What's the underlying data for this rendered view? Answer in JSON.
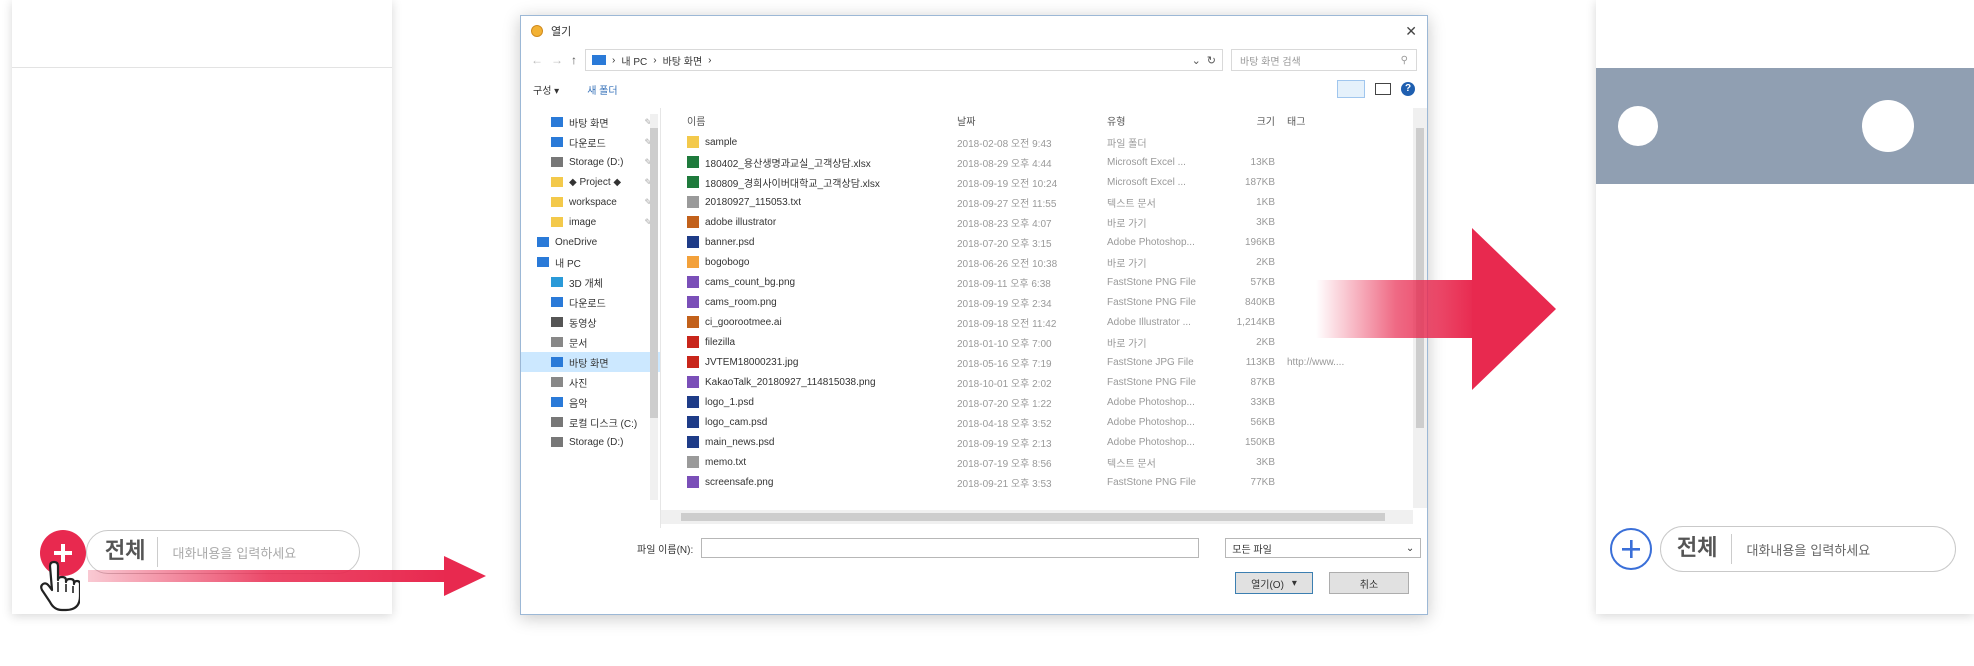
{
  "left_phone": {
    "all_label": "전체",
    "placeholder": "대화내용을 입력하세요"
  },
  "dialog": {
    "title": "열기",
    "address": {
      "pc": "내 PC",
      "folder": "바탕 화면"
    },
    "search_placeholder": "바탕 화면 검색",
    "toolbar": {
      "organize": "구성 ▾",
      "new_folder": "새 폴더"
    },
    "nav_items": [
      {
        "label": "바탕 화면",
        "icon": "desktop-icon",
        "color": "#2a7ad8",
        "pinned": true,
        "level": "sub"
      },
      {
        "label": "다운로드",
        "icon": "download-icon",
        "color": "#2a7ad8",
        "pinned": true,
        "level": "sub"
      },
      {
        "label": "Storage (D:)",
        "icon": "drive-icon",
        "color": "#777777",
        "pinned": true,
        "level": "sub"
      },
      {
        "label": "◆ Project ◆",
        "icon": "folder-icon",
        "color": "#f3c94b",
        "pinned": true,
        "level": "sub"
      },
      {
        "label": "workspace",
        "icon": "folder-icon",
        "color": "#f3c94b",
        "pinned": true,
        "level": "sub"
      },
      {
        "label": "image",
        "icon": "folder-icon",
        "color": "#f3c94b",
        "pinned": true,
        "level": "sub"
      },
      {
        "label": "OneDrive",
        "icon": "cloud-icon",
        "color": "#2a7ad8",
        "pinned": false,
        "level": "top"
      },
      {
        "label": "내 PC",
        "icon": "pc-icon",
        "color": "#2a7ad8",
        "pinned": false,
        "level": "top"
      },
      {
        "label": "3D 개체",
        "icon": "cube-icon",
        "color": "#2a9ad8",
        "pinned": false,
        "level": "sub"
      },
      {
        "label": "다운로드",
        "icon": "download-icon",
        "color": "#2a7ad8",
        "pinned": false,
        "level": "sub"
      },
      {
        "label": "동영상",
        "icon": "video-icon",
        "color": "#555555",
        "pinned": false,
        "level": "sub"
      },
      {
        "label": "문서",
        "icon": "document-icon",
        "color": "#888888",
        "pinned": false,
        "level": "sub"
      },
      {
        "label": "바탕 화면",
        "icon": "desktop-icon",
        "color": "#2a7ad8",
        "pinned": false,
        "level": "sub",
        "selected": true
      },
      {
        "label": "사진",
        "icon": "picture-icon",
        "color": "#888888",
        "pinned": false,
        "level": "sub"
      },
      {
        "label": "음악",
        "icon": "music-icon",
        "color": "#2a7ad8",
        "pinned": false,
        "level": "sub"
      },
      {
        "label": "로컬 디스크 (C:)",
        "icon": "drive-icon",
        "color": "#777777",
        "pinned": false,
        "level": "sub"
      },
      {
        "label": "Storage (D:)",
        "icon": "drive-icon",
        "color": "#777777",
        "pinned": false,
        "level": "sub"
      }
    ],
    "columns": {
      "name": "이름",
      "date": "날짜",
      "type": "유형",
      "size": "크기",
      "tag": "태그"
    },
    "files": [
      {
        "name": "sample",
        "date": "2018-02-08 오전 9:43",
        "type": "파일 폴더",
        "size": "",
        "tag": "",
        "color": "#f3c94b"
      },
      {
        "name": "180402_용산생명과교실_고객상담.xlsx",
        "date": "2018-08-29 오후 4:44",
        "type": "Microsoft Excel ...",
        "size": "13KB",
        "tag": "",
        "color": "#1f7a3c"
      },
      {
        "name": "180809_경희사이버대학교_고객상담.xlsx",
        "date": "2018-09-19 오전 10:24",
        "type": "Microsoft Excel ...",
        "size": "187KB",
        "tag": "",
        "color": "#1f7a3c"
      },
      {
        "name": "20180927_115053.txt",
        "date": "2018-09-27 오전 11:55",
        "type": "텍스트 문서",
        "size": "1KB",
        "tag": "",
        "color": "#9a9a9a"
      },
      {
        "name": "adobe illustrator",
        "date": "2018-08-23 오후 4:07",
        "type": "바로 가기",
        "size": "3KB",
        "tag": "",
        "color": "#c2611b"
      },
      {
        "name": "banner.psd",
        "date": "2018-07-20 오후 3:15",
        "type": "Adobe Photoshop...",
        "size": "196KB",
        "tag": "",
        "color": "#1f3c88"
      },
      {
        "name": "bogobogo",
        "date": "2018-06-26 오전 10:38",
        "type": "바로 가기",
        "size": "2KB",
        "tag": "",
        "color": "#f3a13b"
      },
      {
        "name": "cams_count_bg.png",
        "date": "2018-09-11 오후 6:38",
        "type": "FastStone PNG File",
        "size": "57KB",
        "tag": "",
        "color": "#7a4fb8"
      },
      {
        "name": "cams_room.png",
        "date": "2018-09-19 오후 2:34",
        "type": "FastStone PNG File",
        "size": "840KB",
        "tag": "",
        "color": "#7a4fb8"
      },
      {
        "name": "ci_goorootmee.ai",
        "date": "2018-09-18 오전 11:42",
        "type": "Adobe Illustrator ...",
        "size": "1,214KB",
        "tag": "",
        "color": "#c2611b"
      },
      {
        "name": "filezilla",
        "date": "2018-01-10 오후 7:00",
        "type": "바로 가기",
        "size": "2KB",
        "tag": "",
        "color": "#c8261b"
      },
      {
        "name": "JVTEM18000231.jpg",
        "date": "2018-05-16 오후 7:19",
        "type": "FastStone JPG File",
        "size": "113KB",
        "tag": "http://www....",
        "color": "#c8261b"
      },
      {
        "name": "KakaoTalk_20180927_114815038.png",
        "date": "2018-10-01 오후 2:02",
        "type": "FastStone PNG File",
        "size": "87KB",
        "tag": "",
        "color": "#7a4fb8"
      },
      {
        "name": "logo_1.psd",
        "date": "2018-07-20 오후 1:22",
        "type": "Adobe Photoshop...",
        "size": "33KB",
        "tag": "",
        "color": "#1f3c88"
      },
      {
        "name": "logo_cam.psd",
        "date": "2018-04-18 오후 3:52",
        "type": "Adobe Photoshop...",
        "size": "56KB",
        "tag": "",
        "color": "#1f3c88"
      },
      {
        "name": "main_news.psd",
        "date": "2018-09-19 오후 2:13",
        "type": "Adobe Photoshop...",
        "size": "150KB",
        "tag": "",
        "color": "#1f3c88"
      },
      {
        "name": "memo.txt",
        "date": "2018-07-19 오후 8:56",
        "type": "텍스트 문서",
        "size": "3KB",
        "tag": "",
        "color": "#9a9a9a"
      },
      {
        "name": "screensafe.png",
        "date": "2018-09-21 오후 3:53",
        "type": "FastStone PNG File",
        "size": "77KB",
        "tag": "",
        "color": "#7a4fb8"
      }
    ],
    "filename_label": "파일 이름(N):",
    "filetype": "모든 파일",
    "open_button": "열기(O)",
    "cancel_button": "취소"
  },
  "right_phone": {
    "all_label": "전체",
    "placeholder": "대화내용을 입력하세요",
    "band_color": "#909fb2"
  },
  "colors": {
    "accent_red": "#e8294f",
    "accent_blue": "#3a6fd8"
  }
}
